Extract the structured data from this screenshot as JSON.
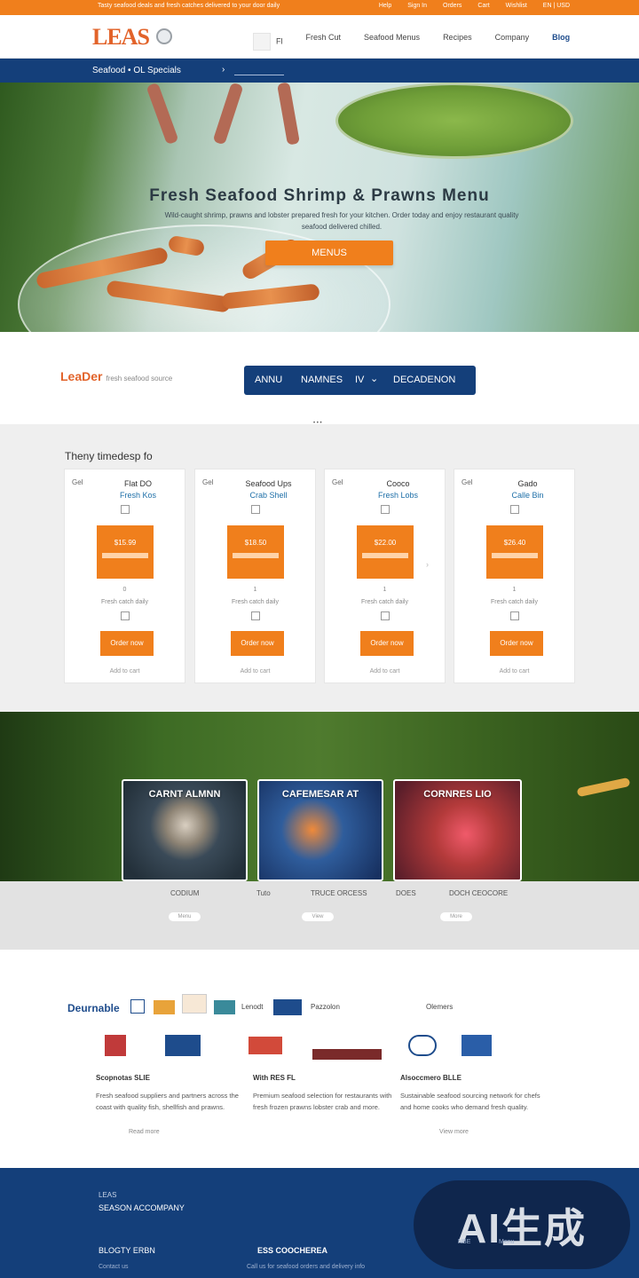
{
  "topbar": {
    "announcement": "Tasty seafood deals and fresh catches delivered to your door daily",
    "links": [
      "Help",
      "Sign In",
      "Orders",
      "Cart",
      "Wishlist"
    ],
    "lang": "EN | USD"
  },
  "header": {
    "logo": "LEAS",
    "nav": [
      "Fresh Cut",
      "Seafood Menus",
      "Recipes",
      "Company"
    ],
    "nav_selected": "Blog",
    "search_prefix": "Fl"
  },
  "subnav": {
    "crumb": "Seafood • OL Specials",
    "chevron": "›"
  },
  "hero": {
    "title": "Fresh Seafood Shrimp & Prawns Menu",
    "subtitle": "Wild-caught shrimp, prawns and lobster prepared fresh for your kitchen. Order today and enjoy restaurant quality seafood delivered chilled.",
    "cta": "MENUS"
  },
  "filter": {
    "brand": "LeaDer",
    "brand_tag": "fresh seafood source",
    "items": [
      "ANNU",
      "NAMNES",
      "IV",
      "DECADENON"
    ],
    "chevron": "⌄"
  },
  "products": {
    "title": "Theny timedesp fo",
    "cards": [
      {
        "label": "Gel",
        "name_top": "Flat DO",
        "name_hl": "Fresh Kos",
        "price_line": "$15.99",
        "note1": "0",
        "note2": "Fresh catch daily",
        "button": "Order now",
        "foot": "Add to cart"
      },
      {
        "label": "Gel",
        "name_top": "Seafood Ups",
        "name_hl": "Crab Shell",
        "price_line": "$18.50",
        "note1": "1",
        "note2": "Fresh catch daily",
        "button": "Order now",
        "foot": "Add to cart"
      },
      {
        "label": "Gel",
        "name_top": "Cooco",
        "name_hl": "Fresh Lobs",
        "price_line": "$22.00",
        "note1": "1",
        "note2": "Fresh catch daily",
        "button": "Order now",
        "foot": "Add to cart"
      },
      {
        "label": "Gel",
        "name_top": "Gado",
        "name_hl": "Calle Bin",
        "price_line": "$26.40",
        "note1": "1",
        "note2": "Fresh catch daily",
        "button": "Order now",
        "foot": "Add to cart"
      }
    ],
    "prev": "‹",
    "next": "›"
  },
  "gallery": {
    "tiles": [
      "CARNT ALMNN",
      "CAFEMESAR AT",
      "CORNRES LIO"
    ],
    "captions": [
      "CODIUM",
      "Tuto",
      "TRUCE ORCESS",
      "DOES",
      "DOCH CEOCORE"
    ],
    "pills": [
      "Menu",
      "View",
      "More"
    ]
  },
  "partners": {
    "title": "Deurnable",
    "logos_text": [
      "Lenodt",
      "Pazzolon",
      "Olemers"
    ],
    "columns": [
      {
        "title": "Scopnotas SLIE",
        "body": "Fresh seafood suppliers and partners across the coast with quality fish, shellfish and prawns.",
        "more": "Read more"
      },
      {
        "title": "With RES FL",
        "body": "Premium seafood selection for restaurants with fresh frozen prawns lobster crab and more.",
        "more": ""
      },
      {
        "title": "Alsoccmero BLLE",
        "body": "Sustainable seafood sourcing network for chefs and home cooks who demand fresh quality.",
        "more": "View more"
      }
    ]
  },
  "footer": {
    "line1": "LEAS",
    "line2": "SEASON ACCOMPANY",
    "line3": "BLOGTY ERBN",
    "line4": "ESS COOCHEREA",
    "line5": "Call us for seafood orders and delivery info",
    "line6": "Contact us",
    "watermark": "AI生成",
    "badge_small": [
      "NBE",
      "Menu"
    ]
  },
  "colors": {
    "orange": "#f07f1c",
    "navy": "#143f7a",
    "logo": "#e2632a"
  }
}
